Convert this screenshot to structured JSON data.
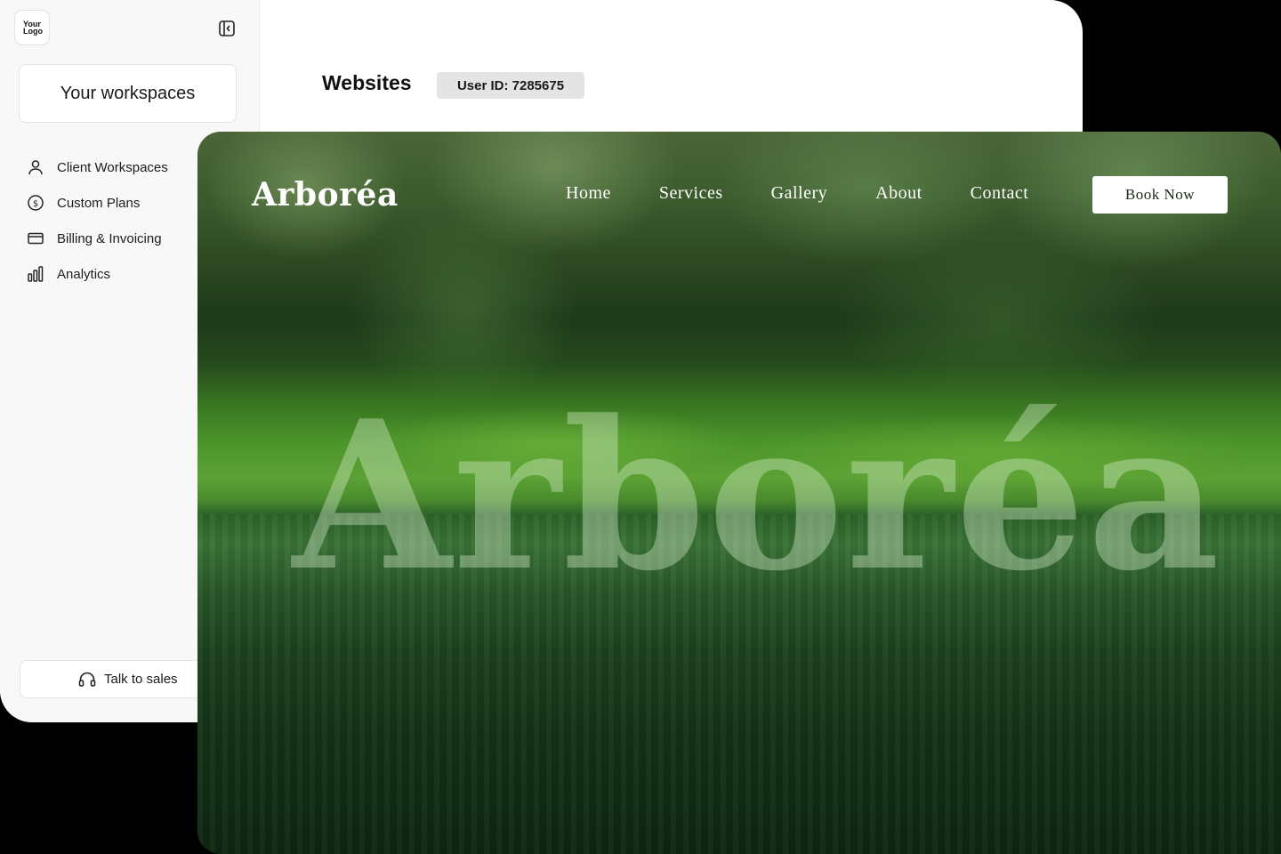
{
  "sidebar": {
    "logo_text": "Your\nLogo",
    "workspace_label": "Your workspaces",
    "items": [
      {
        "label": "Client Workspaces",
        "icon": "user-icon"
      },
      {
        "label": "Custom Plans",
        "icon": "dollar-circle-icon"
      },
      {
        "label": "Billing & Invoicing",
        "icon": "credit-card-icon"
      },
      {
        "label": "Analytics",
        "icon": "bar-chart-icon"
      }
    ],
    "talk_to_sales": "Talk to sales"
  },
  "main": {
    "title": "Websites",
    "user_id_badge": "User ID: 7285675"
  },
  "preview": {
    "site_name": "Arboréa",
    "nav": [
      "Home",
      "Services",
      "Gallery",
      "About",
      "Contact"
    ],
    "cta": "Book Now",
    "hero_text": "Arboréa"
  },
  "colors": {
    "background": "#000000",
    "panel": "#ffffff",
    "sidebar": "#f8f8f8",
    "badge": "#e4e4e4",
    "forest_green": "#2e5a22"
  }
}
